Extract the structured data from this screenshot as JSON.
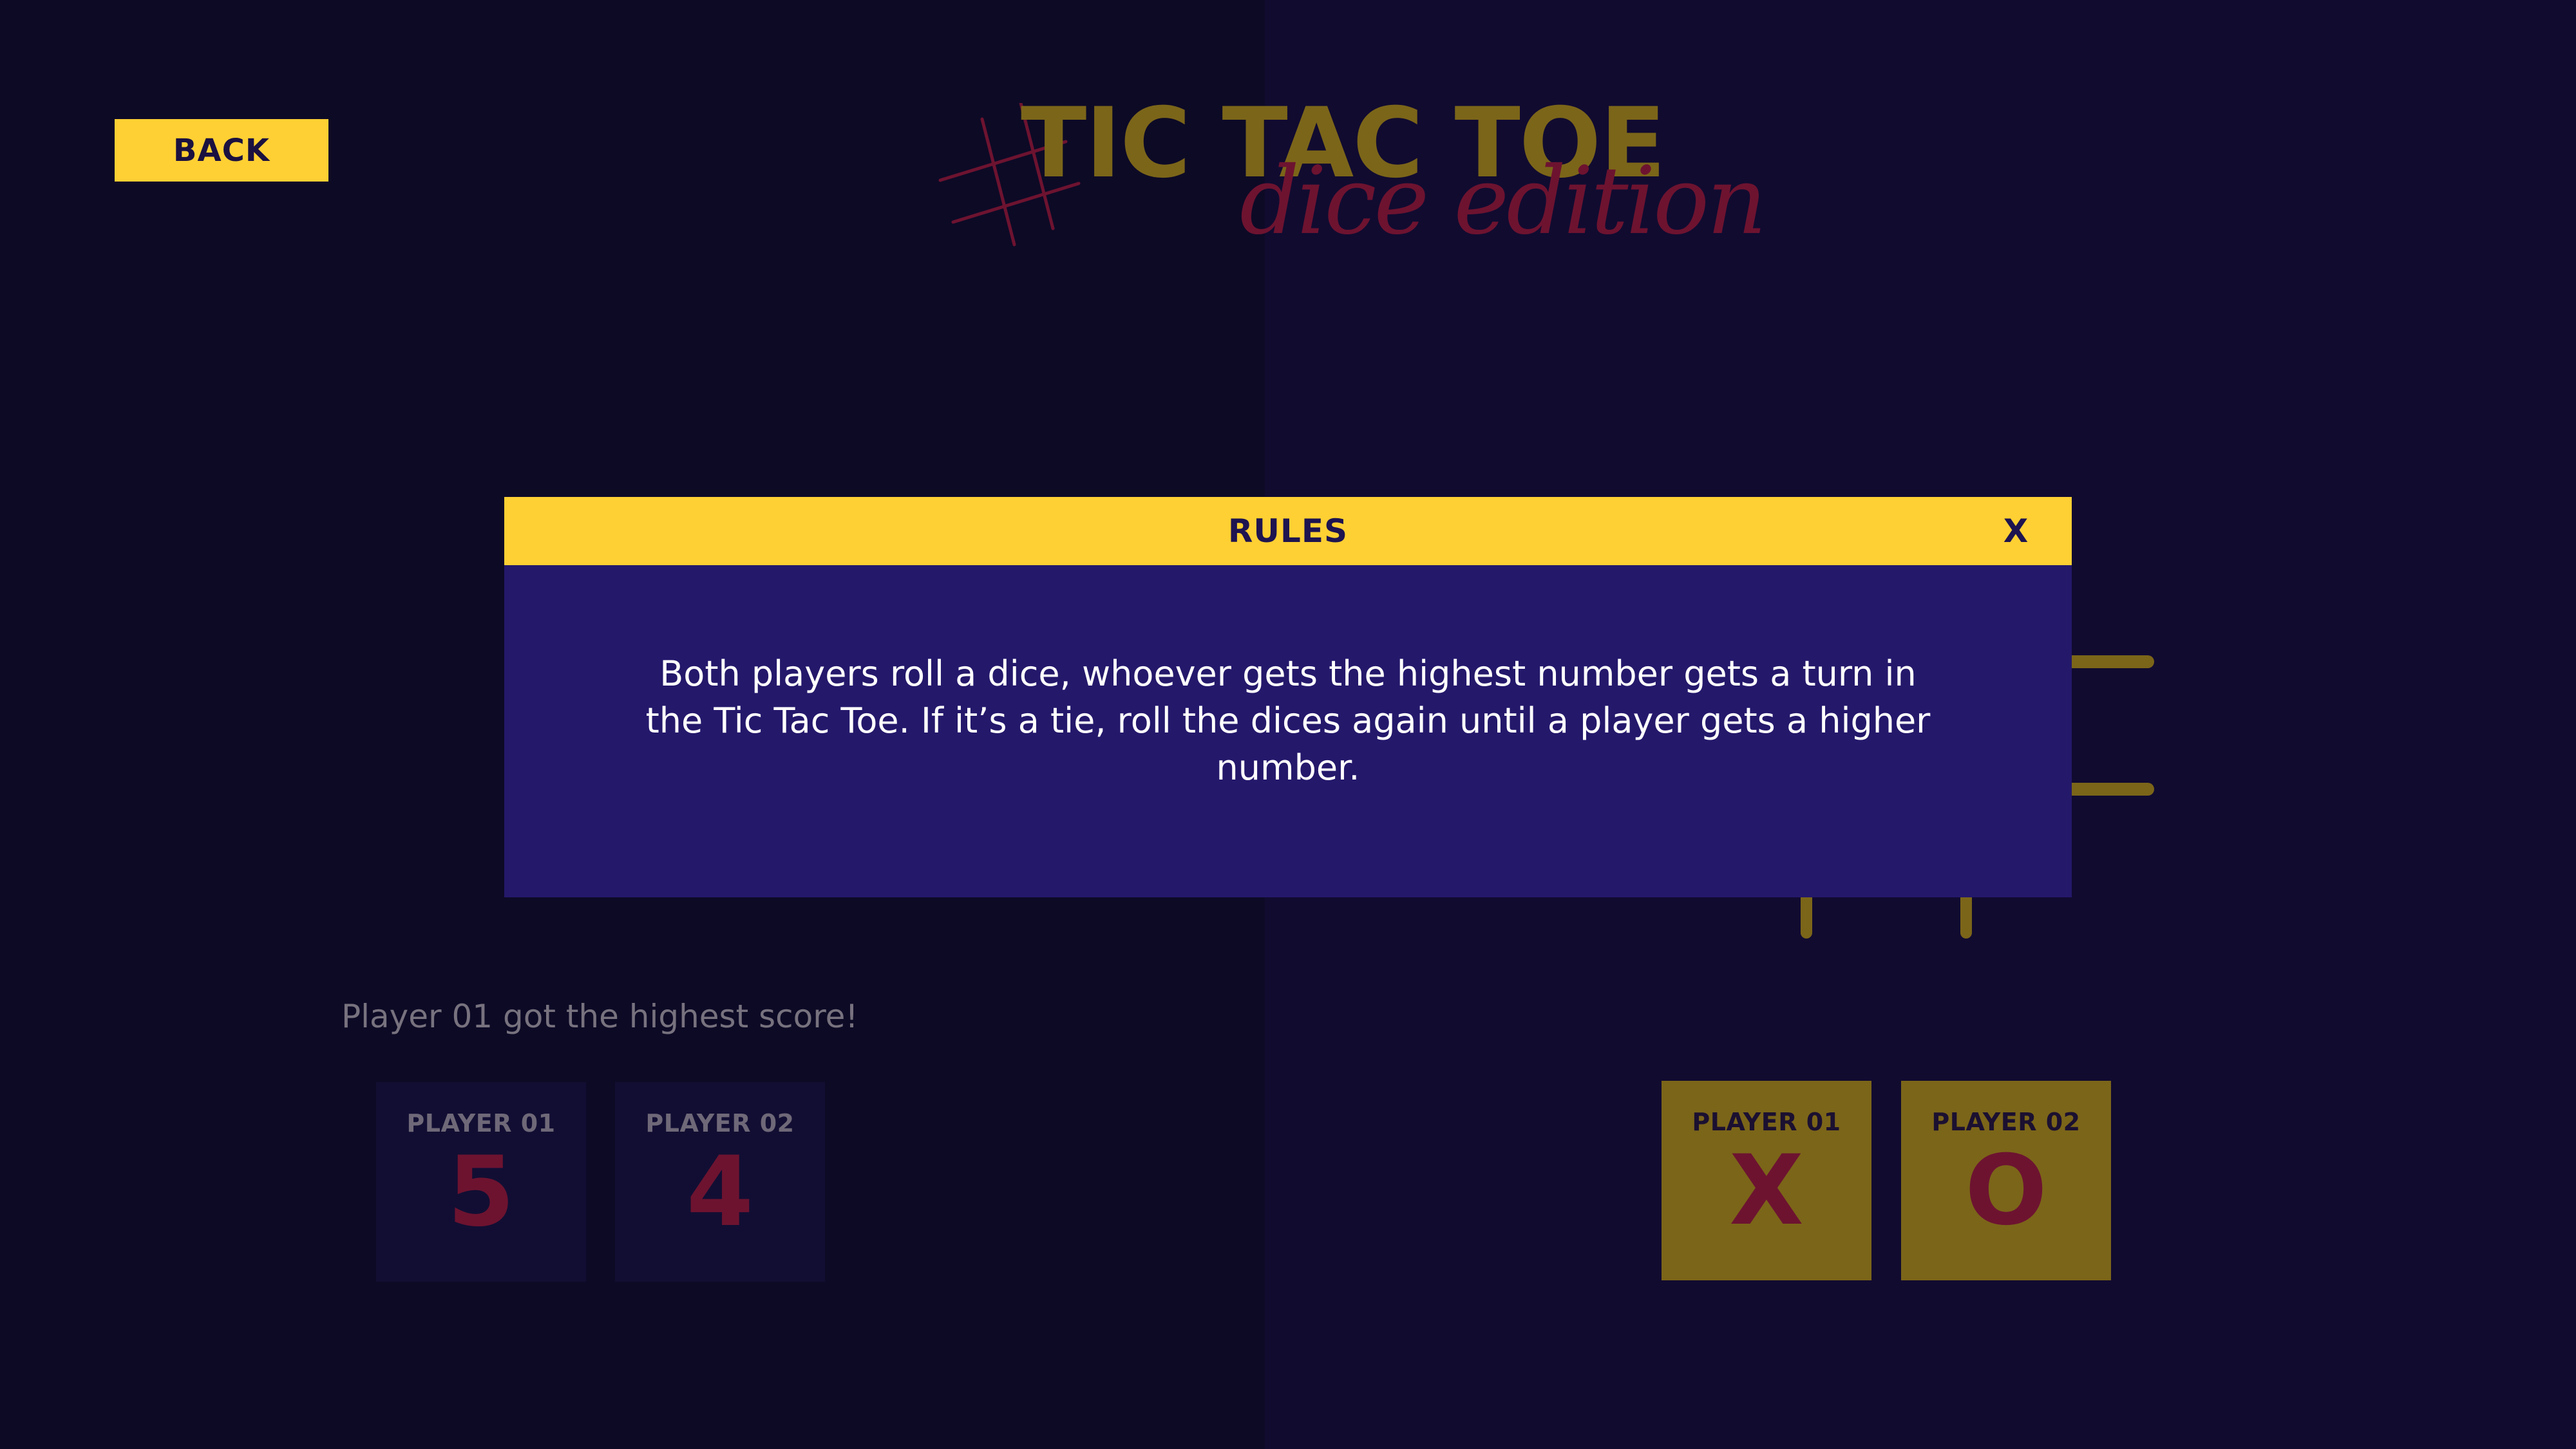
{
  "nav": {
    "back_label": "BACK"
  },
  "logo": {
    "title": "TIC TAC TOE",
    "subtitle": "dice edition"
  },
  "dice": {
    "result_message": "Player 01 got the highest score!",
    "players": [
      {
        "label": "PLAYER 01",
        "value": "5"
      },
      {
        "label": "PLAYER 02",
        "value": "4"
      }
    ]
  },
  "marks": {
    "players": [
      {
        "label": "PLAYER 01",
        "mark": "X"
      },
      {
        "label": "PLAYER 02",
        "mark": "O"
      }
    ]
  },
  "modal": {
    "title": "RULES",
    "close_label": "X",
    "body": "Both players roll a dice, whoever gets the highest number gets a turn in the Tic Tac Toe. If it’s a tie, roll the dices again until a player gets a higher number."
  },
  "colors": {
    "accent_yellow": "#ffd033",
    "dark_gold": "#7b6519",
    "crimson": "#6d1330",
    "modal_bg": "#24186b"
  }
}
